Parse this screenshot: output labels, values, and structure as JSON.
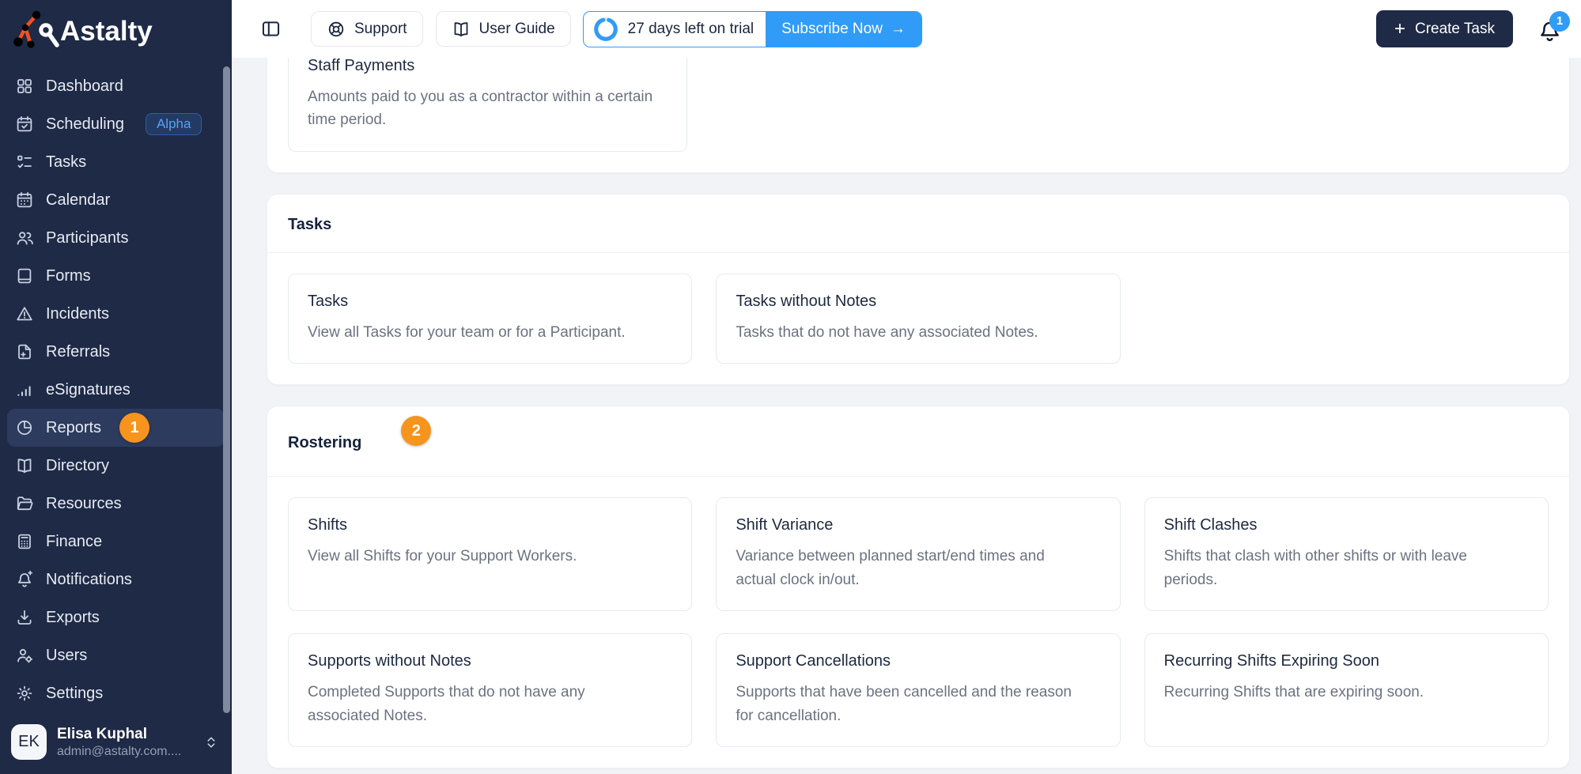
{
  "app": {
    "name": "Astalty"
  },
  "topbar": {
    "support": "Support",
    "user_guide": "User Guide",
    "trial_text": "27 days left on trial",
    "subscribe": "Subscribe Now",
    "subscribe_arrow": "→",
    "create_task_plus": "+",
    "create_task": "Create Task",
    "bell_count": "1"
  },
  "sidebar": {
    "items": [
      {
        "label": "Dashboard"
      },
      {
        "label": "Scheduling",
        "badge": "Alpha"
      },
      {
        "label": "Tasks"
      },
      {
        "label": "Calendar"
      },
      {
        "label": "Participants"
      },
      {
        "label": "Forms"
      },
      {
        "label": "Incidents"
      },
      {
        "label": "Referrals"
      },
      {
        "label": "eSignatures"
      },
      {
        "label": "Reports"
      },
      {
        "label": "Directory"
      },
      {
        "label": "Resources"
      },
      {
        "label": "Finance"
      },
      {
        "label": "Notifications"
      },
      {
        "label": "Exports"
      },
      {
        "label": "Users"
      },
      {
        "label": "Settings"
      }
    ],
    "user": {
      "initials": "EK",
      "name": "Elisa Kuphal",
      "email": "admin@astalty.com...."
    }
  },
  "annotations": {
    "marker1": "1",
    "marker2": "2"
  },
  "sections": {
    "payments": {
      "cards": [
        {
          "title": "Staff Payments",
          "desc": "Amounts paid to you as a contractor within a certain time period."
        }
      ]
    },
    "tasks": {
      "title": "Tasks",
      "cards": [
        {
          "title": "Tasks",
          "desc": "View all Tasks for your team or for a Participant."
        },
        {
          "title": "Tasks without Notes",
          "desc": "Tasks that do not have any associated Notes."
        }
      ]
    },
    "rostering": {
      "title": "Rostering",
      "cards": [
        {
          "title": "Shifts",
          "desc": "View all Shifts for your Support Workers."
        },
        {
          "title": "Shift Variance",
          "desc": "Variance between planned start/end times and actual clock in/out."
        },
        {
          "title": "Shift Clashes",
          "desc": "Shifts that clash with other shifts or with leave periods."
        },
        {
          "title": "Supports without Notes",
          "desc": "Completed Supports that do not have any associated Notes."
        },
        {
          "title": "Support Cancellations",
          "desc": "Supports that have been cancelled and the reason for cancellation."
        },
        {
          "title": "Recurring Shifts Expiring Soon",
          "desc": "Recurring Shifts that are expiring soon."
        }
      ]
    }
  },
  "colors": {
    "sidebar_navy": "#1E2A46",
    "accent_blue": "#309CF7",
    "marker_orange": "#F7941D",
    "logo_orange": "#F4511E"
  }
}
